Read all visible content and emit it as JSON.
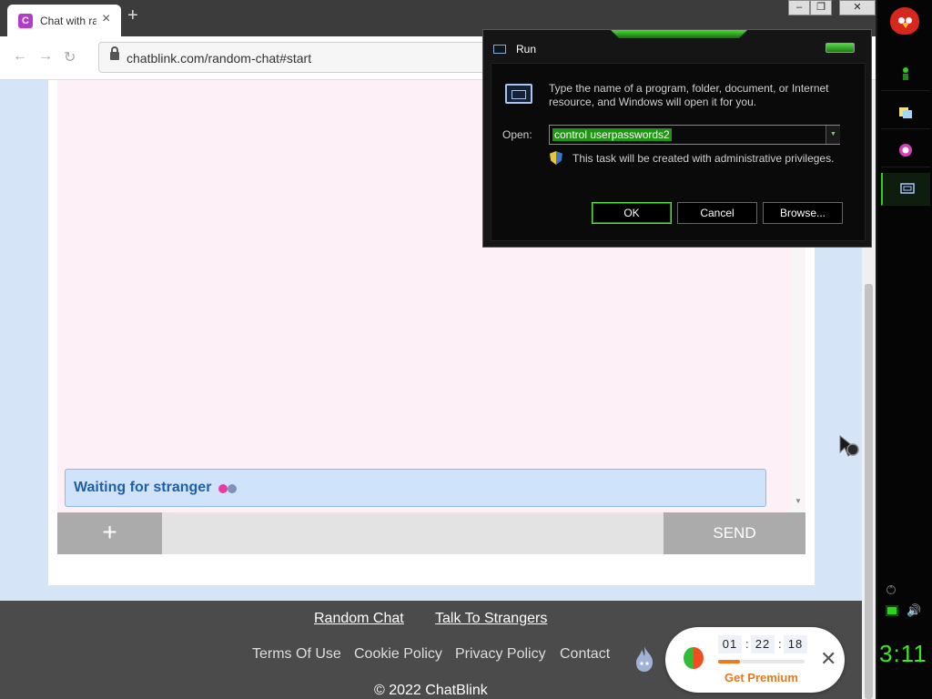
{
  "browser": {
    "tab_title": "Chat with ra",
    "tab_favicon": "C",
    "tab_close": "×",
    "new_tab": "+",
    "url": "chatblink.com/random-chat#start",
    "nav_back": "←",
    "nav_forward": "→",
    "nav_reload": "↻",
    "window_min": "–",
    "window_restore": "❐",
    "window_close": "✕"
  },
  "chat": {
    "status_text": "Waiting for stranger",
    "plus_label": "+",
    "message_placeholder": "",
    "send_label": "SEND",
    "dot_colors": [
      "#e83aa5",
      "#7d93b8"
    ]
  },
  "footer": {
    "primary_links": [
      "Random Chat",
      "Talk To Strangers"
    ],
    "secondary_links": [
      "Terms Of Use",
      "Cookie Policy",
      "Privacy Policy",
      "Contact"
    ],
    "copyright": "© 2022 ChatBlink"
  },
  "premium_widget": {
    "timer": [
      "01",
      "22",
      "18"
    ],
    "separator": ":",
    "progress": 0.25,
    "cta": "Get Premium",
    "close": "✕",
    "icon": "pie-icon",
    "colors": {
      "accent": "#e8781c",
      "pie_red": "#ef4e23",
      "pie_green": "#2ebd34"
    }
  },
  "run_dialog": {
    "title": "Run",
    "description": "Type the name of a program, folder, document, or Internet resource, and Windows will open it for you.",
    "open_label": "Open:",
    "input_value": "control userpasswords2",
    "admin_note": "This task will be created with administrative privileges.",
    "buttons": {
      "ok": "OK",
      "cancel": "Cancel",
      "browse": "Browse..."
    },
    "dropdown_arrow": "▼",
    "accent_color": "#2ecf1a"
  },
  "taskbar": {
    "items": [
      {
        "icon": "angry-bird-icon"
      },
      {
        "icon": "green-figure-icon"
      },
      {
        "icon": "notes-icon"
      },
      {
        "icon": "pink-orb-icon"
      },
      {
        "icon": "run-window-icon",
        "active": true
      }
    ],
    "tray_up": "^",
    "volume_icon": "🔊",
    "clock": "3:11"
  }
}
